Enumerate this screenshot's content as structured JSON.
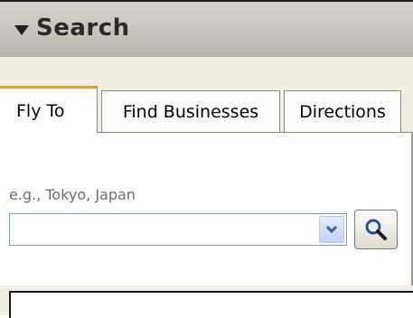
{
  "header": {
    "title": "Search",
    "collapse_icon": "triangle-down-icon"
  },
  "tabs": [
    {
      "label": "Fly To",
      "active": true
    },
    {
      "label": "Find Businesses",
      "active": false
    },
    {
      "label": "Directions",
      "active": false
    }
  ],
  "fly_to": {
    "hint": "e.g., Tokyo, Japan",
    "input_value": "",
    "dropdown_icon": "chevron-down-icon",
    "search_icon": "magnifier-icon"
  },
  "colors": {
    "active_tab_accent": "#f0a000",
    "panel_background": "#f1efe2",
    "header_background": "#c8c5bb"
  }
}
